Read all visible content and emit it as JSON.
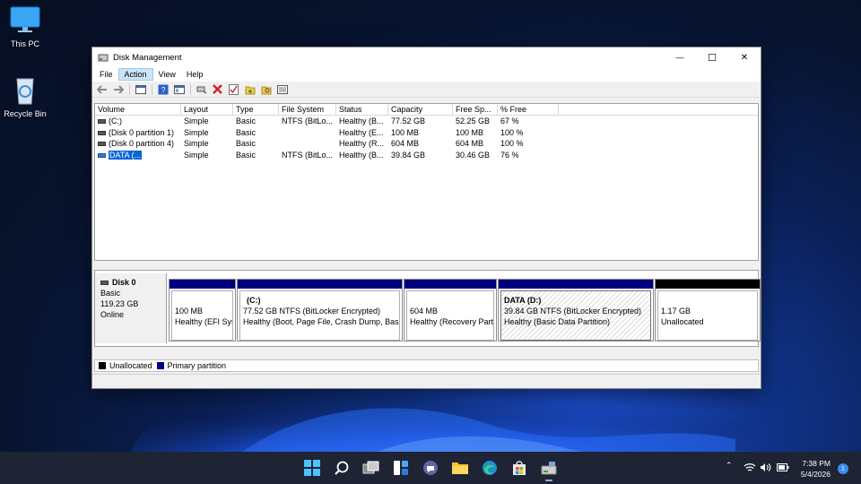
{
  "desktop": {
    "icons": [
      {
        "label": "This PC"
      },
      {
        "label": "Recycle Bin"
      }
    ]
  },
  "window": {
    "title": "Disk Management",
    "controls": {
      "minimize": "—",
      "maximize": "☐",
      "close": "✕"
    }
  },
  "menu": {
    "items": [
      {
        "label": "File"
      },
      {
        "label": "Action"
      },
      {
        "label": "View"
      },
      {
        "label": "Help"
      }
    ]
  },
  "volume_table": {
    "columns": [
      "Volume",
      "Layout",
      "Type",
      "File System",
      "Status",
      "Capacity",
      "Free Sp...",
      "% Free"
    ],
    "rows": [
      {
        "volume": "(C:)",
        "layout": "Simple",
        "type": "Basic",
        "fs": "NTFS (BitLo...",
        "status": "Healthy (B...",
        "capacity": "77.52 GB",
        "free": "52.25 GB",
        "pct": "67 %"
      },
      {
        "volume": "(Disk 0 partition 1)",
        "layout": "Simple",
        "type": "Basic",
        "fs": "",
        "status": "Healthy (E...",
        "capacity": "100 MB",
        "free": "100 MB",
        "pct": "100 %"
      },
      {
        "volume": "(Disk 0 partition 4)",
        "layout": "Simple",
        "type": "Basic",
        "fs": "",
        "status": "Healthy (R...",
        "capacity": "604 MB",
        "free": "604 MB",
        "pct": "100 %"
      },
      {
        "volume": "DATA (...",
        "layout": "Simple",
        "type": "Basic",
        "fs": "NTFS (BitLo...",
        "status": "Healthy (B...",
        "capacity": "39.84 GB",
        "free": "30.46 GB",
        "pct": "76 %"
      }
    ]
  },
  "disk": {
    "name": "Disk 0",
    "type": "Basic",
    "size": "119.23 GB",
    "state": "Online",
    "partitions": [
      {
        "title": "",
        "line1": "100 MB",
        "line2": "Healthy (EFI Sys"
      },
      {
        "title": "(C:)",
        "line1": "77.52 GB NTFS (BitLocker Encrypted)",
        "line2": "Healthy (Boot, Page File, Crash Dump, Basic"
      },
      {
        "title": "",
        "line1": "604 MB",
        "line2": "Healthy (Recovery Parti"
      },
      {
        "title": "DATA  (D:)",
        "line1": "39.84 GB NTFS (BitLocker Encrypted)",
        "line2": "Healthy (Basic Data Partition)"
      },
      {
        "title": "",
        "line1": "1.17 GB",
        "line2": "Unallocated"
      }
    ]
  },
  "legend": {
    "unallocated": "Unallocated",
    "primary": "Primary partition",
    "unallocated_color": "#000000",
    "primary_color": "#00007f"
  },
  "taskbar": {
    "time": "7:38 PM",
    "date": "5/4/2026",
    "notifications": "1",
    "accent": "#1e2433"
  }
}
